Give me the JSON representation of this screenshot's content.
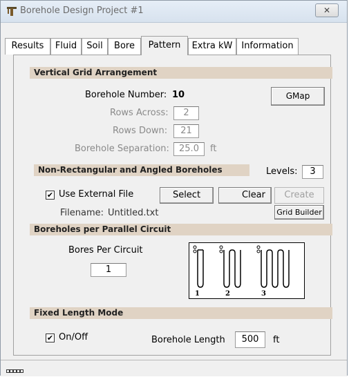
{
  "window": {
    "title": "Borehole Design Project #1",
    "close_glyph": "✕"
  },
  "tabs": [
    {
      "label": "Results"
    },
    {
      "label": "Fluid"
    },
    {
      "label": "Soil"
    },
    {
      "label": "Bore"
    },
    {
      "label": "Pattern",
      "active": true
    },
    {
      "label": "Extra kW"
    },
    {
      "label": "Information"
    }
  ],
  "vertical_grid": {
    "header": "Vertical Grid Arrangement",
    "borehole_number_label": "Borehole Number:",
    "borehole_number_value": "10",
    "gmap_button": "GMap",
    "rows_across_label": "Rows Across:",
    "rows_across_value": "2",
    "rows_down_label": "Rows Down:",
    "rows_down_value": "21",
    "separation_label": "Borehole Separation:",
    "separation_value": "25.0",
    "separation_unit": "ft"
  },
  "non_rect": {
    "header": "Non-Rectangular and Angled Boreholes",
    "levels_label": "Levels:",
    "levels_value": "3",
    "use_external_label": "Use External File",
    "use_external_checked": true,
    "select_button": "Select",
    "clear_button": "Clear",
    "create_button": "Create",
    "filename_label": "Filename:",
    "filename_value": "Untitled.txt",
    "grid_builder_button": "Grid Builder"
  },
  "parallel": {
    "header": "Boreholes per Parallel Circuit",
    "bores_per_circuit_label": "Bores Per Circuit",
    "bores_per_circuit_value": "1",
    "diagram_labels": [
      "1",
      "2",
      "3"
    ]
  },
  "fixed_length": {
    "header": "Fixed Length Mode",
    "onoff_label": "On/Off",
    "onoff_checked": true,
    "borehole_length_label": "Borehole Length",
    "borehole_length_value": "500",
    "borehole_length_unit": "ft"
  },
  "checkmark_glyph": "✔"
}
